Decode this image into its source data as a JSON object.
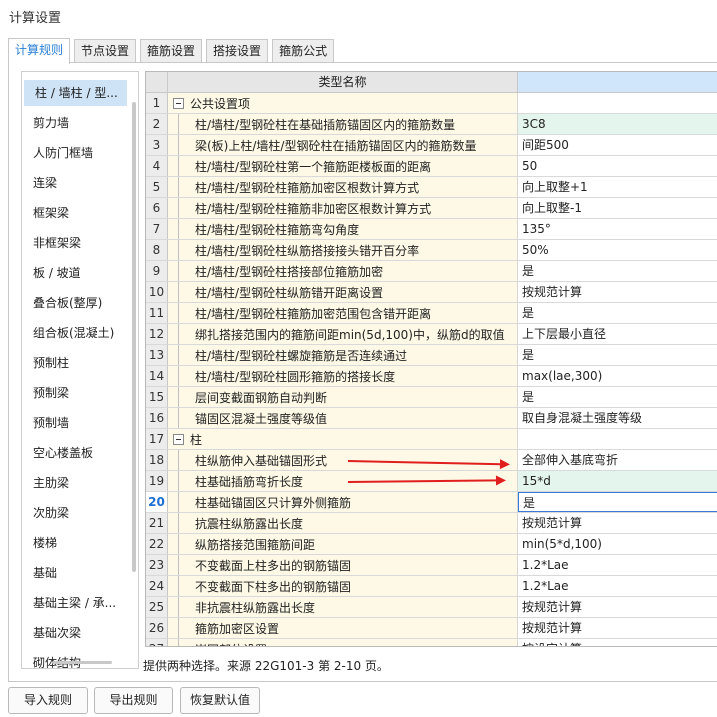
{
  "window": {
    "title": "计算设置"
  },
  "tabs": [
    {
      "label": "计算规则",
      "active": true
    },
    {
      "label": "节点设置",
      "active": false
    },
    {
      "label": "箍筋设置",
      "active": false
    },
    {
      "label": "搭接设置",
      "active": false
    },
    {
      "label": "箍筋公式",
      "active": false
    }
  ],
  "sidebar": {
    "items": [
      {
        "label": "柱 / 墙柱 / 型...",
        "selected": true
      },
      {
        "label": "剪力墙"
      },
      {
        "label": "人防门框墙"
      },
      {
        "label": "连梁"
      },
      {
        "label": "框架梁"
      },
      {
        "label": "非框架梁"
      },
      {
        "label": "板 / 坡道"
      },
      {
        "label": "叠合板(整厚)"
      },
      {
        "label": "组合板(混凝土)"
      },
      {
        "label": "预制柱"
      },
      {
        "label": "预制梁"
      },
      {
        "label": "预制墙"
      },
      {
        "label": "空心楼盖板"
      },
      {
        "label": "主肋梁"
      },
      {
        "label": "次肋梁"
      },
      {
        "label": "楼梯"
      },
      {
        "label": "基础"
      },
      {
        "label": "基础主梁 / 承..."
      },
      {
        "label": "基础次梁"
      },
      {
        "label": "砌体结构"
      }
    ]
  },
  "grid": {
    "header_name": "类型名称",
    "rows": [
      {
        "num": "1",
        "name": "公共设置项",
        "value": "",
        "group": true
      },
      {
        "num": "2",
        "name": "柱/墙柱/型钢砼柱在基础插筋锚固区内的箍筋数量",
        "value": "3C8",
        "green": true
      },
      {
        "num": "3",
        "name": "梁(板)上柱/墙柱/型钢砼柱在插筋锚固区内的箍筋数量",
        "value": "间距500"
      },
      {
        "num": "4",
        "name": "柱/墙柱/型钢砼柱第一个箍筋距楼板面的距离",
        "value": "50"
      },
      {
        "num": "5",
        "name": "柱/墙柱/型钢砼柱箍筋加密区根数计算方式",
        "value": "向上取整+1"
      },
      {
        "num": "6",
        "name": "柱/墙柱/型钢砼柱箍筋非加密区根数计算方式",
        "value": "向上取整-1"
      },
      {
        "num": "7",
        "name": "柱/墙柱/型钢砼柱箍筋弯勾角度",
        "value": "135°"
      },
      {
        "num": "8",
        "name": "柱/墙柱/型钢砼柱纵筋搭接接头错开百分率",
        "value": "50%"
      },
      {
        "num": "9",
        "name": "柱/墙柱/型钢砼柱搭接部位箍筋加密",
        "value": "是"
      },
      {
        "num": "10",
        "name": "柱/墙柱/型钢砼柱纵筋错开距离设置",
        "value": "按规范计算"
      },
      {
        "num": "11",
        "name": "柱/墙柱/型钢砼柱箍筋加密范围包含错开距离",
        "value": "是"
      },
      {
        "num": "12",
        "name": "绑扎搭接范围内的箍筋间距min(5d,100)中，纵筋d的取值",
        "value": "上下层最小直径"
      },
      {
        "num": "13",
        "name": "柱/墙柱/型钢砼柱螺旋箍筋是否连续通过",
        "value": "是"
      },
      {
        "num": "14",
        "name": "柱/墙柱/型钢砼柱圆形箍筋的搭接长度",
        "value": "max(lae,300)"
      },
      {
        "num": "15",
        "name": "层间变截面钢筋自动判断",
        "value": "是"
      },
      {
        "num": "16",
        "name": "锚固区混凝土强度等级值",
        "value": "取自身混凝土强度等级"
      },
      {
        "num": "17",
        "name": "柱",
        "value": "",
        "group": true
      },
      {
        "num": "18",
        "name": "柱纵筋伸入基础锚固形式",
        "value": "全部伸入基底弯折"
      },
      {
        "num": "19",
        "name": "柱基础插筋弯折长度",
        "value": "15*d",
        "green": true
      },
      {
        "num": "20",
        "name": "柱基础锚固区只计算外侧箍筋",
        "value": "是",
        "selected": true
      },
      {
        "num": "21",
        "name": "抗震柱纵筋露出长度",
        "value": "按规范计算"
      },
      {
        "num": "22",
        "name": "纵筋搭接范围箍筋间距",
        "value": "min(5*d,100)"
      },
      {
        "num": "23",
        "name": "不变截面上柱多出的钢筋锚固",
        "value": "1.2*Lae"
      },
      {
        "num": "24",
        "name": "不变截面下柱多出的钢筋锚固",
        "value": "1.2*Lae"
      },
      {
        "num": "25",
        "name": "非抗震柱纵筋露出长度",
        "value": "按规范计算"
      },
      {
        "num": "26",
        "name": "箍筋加密区设置",
        "value": "按规范计算"
      },
      {
        "num": "27",
        "name": "嵌固部位设置",
        "value": "按设定计算"
      }
    ]
  },
  "note": "提供两种选择。来源 22G101-3 第 2-10 页。",
  "buttons": {
    "import": "导入规则",
    "export": "导出规则",
    "restore": "恢复默认值"
  },
  "colors": {
    "accent": "#2a7fd4",
    "arrow": "#e01e1e",
    "name_bg": "#fdf9e6",
    "value_green": "#e3f5ec",
    "header_value_bg": "#d0e6fa"
  }
}
